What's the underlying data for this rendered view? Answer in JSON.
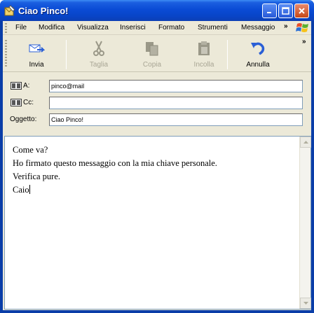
{
  "window": {
    "title": "Ciao Pinco!"
  },
  "menu": {
    "items": [
      "File",
      "Modifica",
      "Visualizza",
      "Inserisci",
      "Formato",
      "Strumenti",
      "Messaggio"
    ],
    "more": "»"
  },
  "toolbar": {
    "buttons": [
      {
        "label": "Invia",
        "icon": "send-icon",
        "enabled": true
      },
      {
        "label": "Taglia",
        "icon": "scissors-icon",
        "enabled": false
      },
      {
        "label": "Copia",
        "icon": "copy-icon",
        "enabled": false
      },
      {
        "label": "Incolla",
        "icon": "paste-icon",
        "enabled": false
      },
      {
        "label": "Annulla",
        "icon": "undo-icon",
        "enabled": true
      }
    ],
    "more": "»"
  },
  "fields": {
    "to_label": "A:",
    "to_value": "pinco@mail",
    "cc_label": "Cc:",
    "cc_value": "",
    "subject_label": "Oggetto:",
    "subject_value": "Ciao Pinco!"
  },
  "body": {
    "lines": [
      "Come va?",
      "Ho firmato questo messaggio con la mia chiave personale.",
      "Verifica pure.",
      "Caio"
    ]
  },
  "colors": {
    "titlebar": "#0a4bd5",
    "client": "#ece9d8",
    "close_button": "#c64717",
    "accent_blue": "#2a5fd6"
  }
}
